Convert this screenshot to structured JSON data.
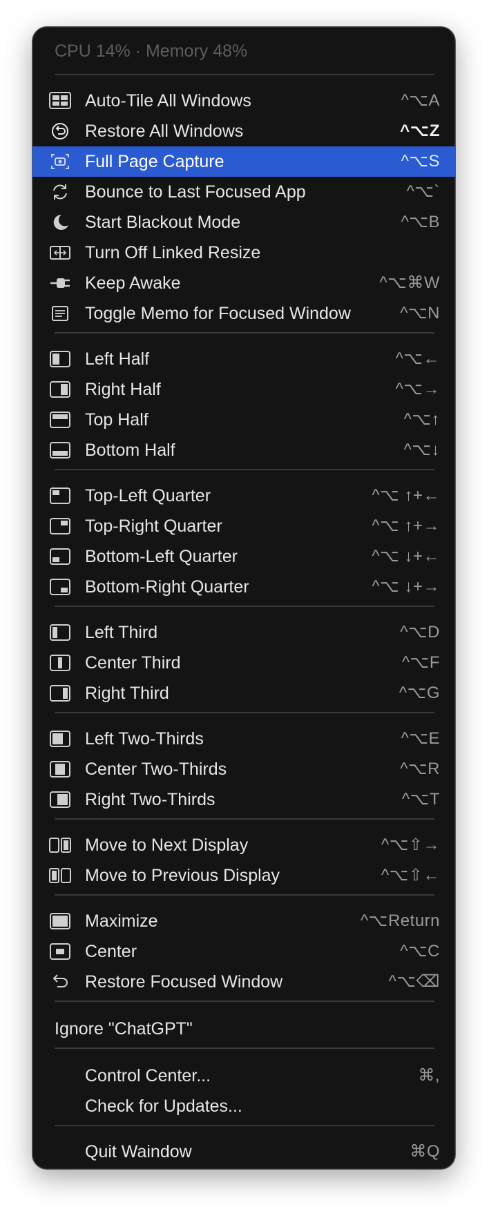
{
  "header": {
    "status": "CPU 14% · Memory 48%"
  },
  "items": [
    {
      "label": "Auto-Tile All Windows",
      "shortcut": "^⌥A",
      "icon": "grid-icon"
    },
    {
      "label": "Restore All Windows",
      "shortcut": "^⌥Z",
      "icon": "restore-circle-icon"
    },
    {
      "label": "Full Page Capture",
      "shortcut": "^⌥S",
      "icon": "camera-icon"
    },
    {
      "label": "Bounce to Last Focused App",
      "shortcut": "^⌥`",
      "icon": "sync-icon"
    },
    {
      "label": "Start Blackout Mode",
      "shortcut": "^⌥B",
      "icon": "moon-icon"
    },
    {
      "label": "Turn Off Linked Resize",
      "shortcut": "",
      "icon": "linked-resize-icon"
    },
    {
      "label": "Keep Awake",
      "shortcut": "^⌥⌘W",
      "icon": "plug-icon"
    },
    {
      "label": "Toggle Memo for Focused Window",
      "shortcut": "^⌥N",
      "icon": "memo-icon"
    },
    {
      "label": "Left Half",
      "shortcut": "^⌥←",
      "icon": "left-half-icon"
    },
    {
      "label": "Right Half",
      "shortcut": "^⌥→",
      "icon": "right-half-icon"
    },
    {
      "label": "Top Half",
      "shortcut": "^⌥↑",
      "icon": "top-half-icon"
    },
    {
      "label": "Bottom Half",
      "shortcut": "^⌥↓",
      "icon": "bottom-half-icon"
    },
    {
      "label": "Top-Left Quarter",
      "shortcut": "^⌥ ↑+←",
      "icon": "top-left-quarter-icon"
    },
    {
      "label": "Top-Right Quarter",
      "shortcut": "^⌥ ↑+→",
      "icon": "top-right-quarter-icon"
    },
    {
      "label": "Bottom-Left Quarter",
      "shortcut": "^⌥ ↓+←",
      "icon": "bottom-left-quarter-icon"
    },
    {
      "label": "Bottom-Right Quarter",
      "shortcut": "^⌥ ↓+→",
      "icon": "bottom-right-quarter-icon"
    },
    {
      "label": "Left Third",
      "shortcut": "^⌥D",
      "icon": "left-third-icon"
    },
    {
      "label": "Center Third",
      "shortcut": "^⌥F",
      "icon": "center-third-icon"
    },
    {
      "label": "Right Third",
      "shortcut": "^⌥G",
      "icon": "right-third-icon"
    },
    {
      "label": "Left Two-Thirds",
      "shortcut": "^⌥E",
      "icon": "left-two-thirds-icon"
    },
    {
      "label": "Center Two-Thirds",
      "shortcut": "^⌥R",
      "icon": "center-two-thirds-icon"
    },
    {
      "label": "Right Two-Thirds",
      "shortcut": "^⌥T",
      "icon": "right-two-thirds-icon"
    },
    {
      "label": "Move to Next Display",
      "shortcut": "^⌥⇧→",
      "icon": "next-display-icon"
    },
    {
      "label": "Move to Previous Display",
      "shortcut": "^⌥⇧←",
      "icon": "previous-display-icon"
    },
    {
      "label": "Maximize",
      "shortcut": "^⌥Return",
      "icon": "maximize-icon"
    },
    {
      "label": "Center",
      "shortcut": "^⌥C",
      "icon": "center-icon"
    },
    {
      "label": "Restore Focused Window",
      "shortcut": "^⌥⌫",
      "icon": "undo-arrow-icon"
    },
    {
      "label": "Ignore \"ChatGPT\"",
      "shortcut": "",
      "icon": ""
    },
    {
      "label": "Control Center...",
      "shortcut": "⌘,",
      "icon": ""
    },
    {
      "label": "Check for Updates...",
      "shortcut": "",
      "icon": ""
    },
    {
      "label": "Quit Waindow",
      "shortcut": "⌘Q",
      "icon": ""
    }
  ],
  "highlighted_item": "Full Page Capture",
  "colors": {
    "menu_bg": "#141414",
    "highlight": "#2a5bd1",
    "text": "#e6e6e6",
    "shortcut": "#9a9a9a",
    "header": "#5d5d5d"
  }
}
